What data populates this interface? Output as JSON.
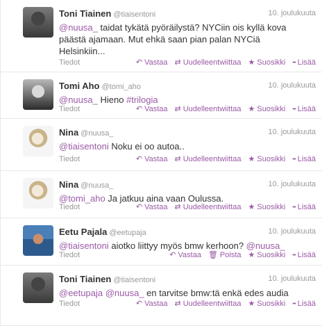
{
  "tweets": [
    {
      "name": "Toni Tiainen",
      "handle": "@tiaisentoni",
      "time": "10. joulukuuta",
      "lines": [
        [
          {
            "t": "@nuusa_",
            "c": "mention"
          },
          {
            "t": " taidat tykätä pyöräilystä? NYCiin ois kyllä kova"
          }
        ],
        [
          {
            "t": "päästä ajamaan. Mut ehkä saan pian palan NYCiä"
          }
        ],
        [
          {
            "t": "Helsinkiin..."
          }
        ]
      ],
      "details": "Tiedot",
      "actions": [
        {
          "label": "Vastaa",
          "icon": "reply-icon",
          "glyph": "↶"
        },
        {
          "label": "Uudelleentwiittaa",
          "icon": "retweet-icon",
          "glyph": "⇄"
        },
        {
          "label": "Suosikki",
          "icon": "star-icon",
          "glyph": "★"
        },
        {
          "label": "Lisää",
          "icon": "more-icon",
          "glyph": "•••"
        }
      ]
    },
    {
      "name": "Tomi Aho",
      "handle": "@tomi_aho",
      "time": "10. joulukuuta",
      "lines": [
        [
          {
            "t": "@nuusa_",
            "c": "mention"
          },
          {
            "t": " Hieno "
          },
          {
            "t": "#trilogia",
            "c": "hashtag"
          }
        ]
      ],
      "details": "Tiedot",
      "actions": [
        {
          "label": "Vastaa",
          "icon": "reply-icon",
          "glyph": "↶"
        },
        {
          "label": "Uudelleentwiittaa",
          "icon": "retweet-icon",
          "glyph": "⇄"
        },
        {
          "label": "Suosikki",
          "icon": "star-icon",
          "glyph": "★"
        },
        {
          "label": "Lisää",
          "icon": "more-icon",
          "glyph": "•••"
        }
      ]
    },
    {
      "name": "Nina",
      "handle": "@nuusa_",
      "time": "10. joulukuuta",
      "lines": [
        [
          {
            "t": "@tiaisentoni",
            "c": "mention"
          },
          {
            "t": " Noku ei oo autoa.."
          }
        ]
      ],
      "details": "Tiedot",
      "actions": [
        {
          "label": "Vastaa",
          "icon": "reply-icon",
          "glyph": "↶"
        },
        {
          "label": "Uudelleentwiittaa",
          "icon": "retweet-icon",
          "glyph": "⇄"
        },
        {
          "label": "Suosikki",
          "icon": "star-icon",
          "glyph": "★"
        },
        {
          "label": "Lisää",
          "icon": "more-icon",
          "glyph": "•••"
        }
      ]
    },
    {
      "name": "Nina",
      "handle": "@nuusa_",
      "time": "10. joulukuuta",
      "lines": [
        [
          {
            "t": "@tomi_aho",
            "c": "mention"
          },
          {
            "t": " Ja jatkuu aina vaan Oulussa."
          }
        ]
      ],
      "details": "Tiedot",
      "actions": [
        {
          "label": "Vastaa",
          "icon": "reply-icon",
          "glyph": "↶"
        },
        {
          "label": "Uudelleentwiittaa",
          "icon": "retweet-icon",
          "glyph": "⇄"
        },
        {
          "label": "Suosikki",
          "icon": "star-icon",
          "glyph": "★"
        },
        {
          "label": "Lisää",
          "icon": "more-icon",
          "glyph": "•••"
        }
      ]
    },
    {
      "name": "Eetu Pajala",
      "handle": "@eetupaja",
      "time": "10. joulukuuta",
      "lines": [
        [
          {
            "t": "@tiaisentoni",
            "c": "mention"
          },
          {
            "t": " aiotko liittyy myös bmw kerhoon? "
          },
          {
            "t": "@nuusa_",
            "c": "mention"
          }
        ]
      ],
      "details": "Tiedot",
      "actions": [
        {
          "label": "Vastaa",
          "icon": "reply-icon",
          "glyph": "↶"
        },
        {
          "label": "Poista",
          "icon": "trash-icon",
          "glyph": "🗑"
        },
        {
          "label": "Suosikki",
          "icon": "star-icon",
          "glyph": "★"
        },
        {
          "label": "Lisää",
          "icon": "more-icon",
          "glyph": "•••"
        }
      ]
    },
    {
      "name": "Toni Tiainen",
      "handle": "@tiaisentoni",
      "time": "10. joulukuuta",
      "lines": [
        [
          {
            "t": "@eetupaja",
            "c": "mention"
          },
          {
            "t": " "
          },
          {
            "t": "@nuusa_",
            "c": "mention"
          },
          {
            "t": " en tarvitse bmw:tä enkä edes audia"
          }
        ]
      ],
      "details": "Tiedot",
      "actions": [
        {
          "label": "Vastaa",
          "icon": "reply-icon",
          "glyph": "↶"
        },
        {
          "label": "Uudelleentwiittaa",
          "icon": "retweet-icon",
          "glyph": "⇄"
        },
        {
          "label": "Suosikki",
          "icon": "star-icon",
          "glyph": "★"
        },
        {
          "label": "Lisää",
          "icon": "more-icon",
          "glyph": "•••"
        }
      ]
    }
  ],
  "colors": {
    "link": "#9b5aa6",
    "muted": "#999999",
    "text": "#333333",
    "divider": "#e8e8e8"
  }
}
